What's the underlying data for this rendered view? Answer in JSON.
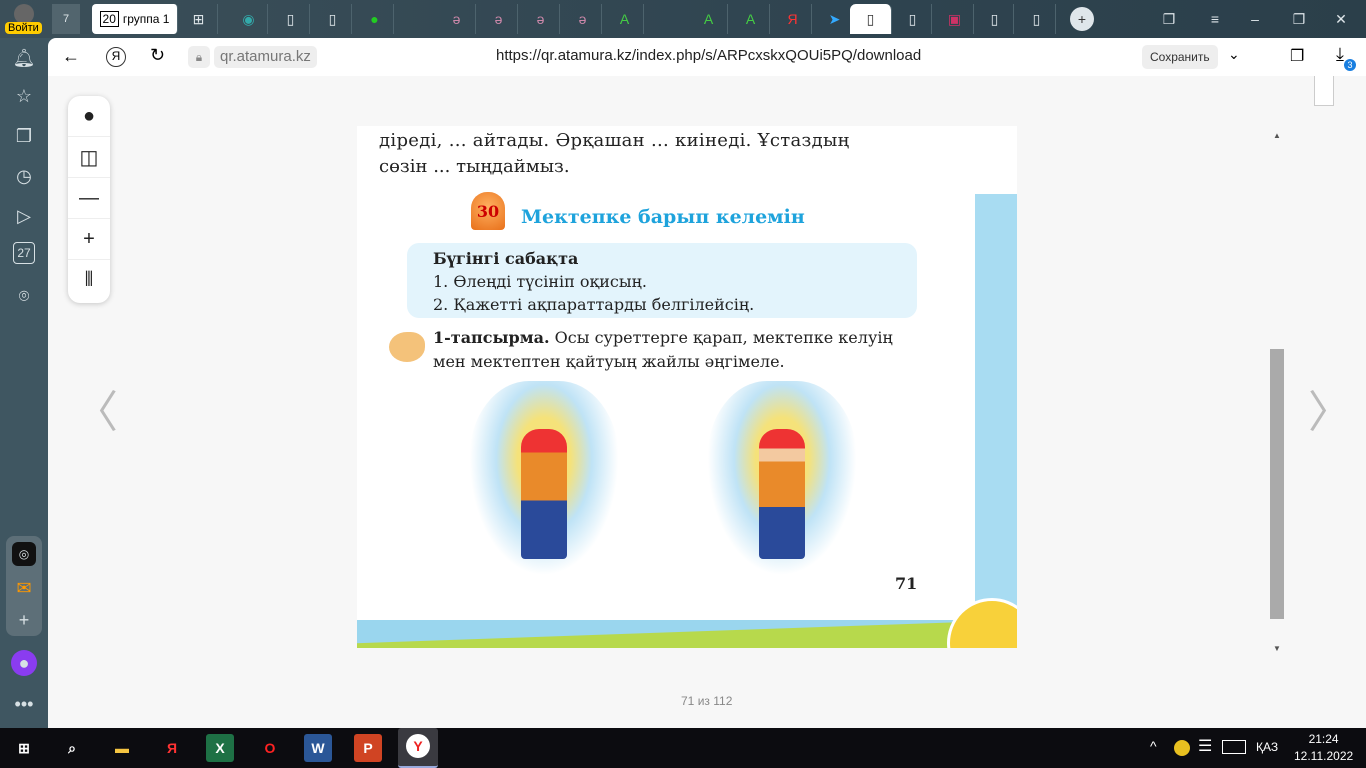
{
  "browser": {
    "login_label": "Войти",
    "home_count": "7",
    "group_count": "20",
    "group_label": "группа 1",
    "url_host": "qr.atamura.kz",
    "url": "https://qr.atamura.kz/index.php/s/ARPcxskxQOUi5PQ/download",
    "save_label": "Сохранить",
    "downloads_badge": "3",
    "sidebar_calendar": "27"
  },
  "page": {
    "line1": "діреді, ... айтады. Әрқашан ... киінеді. Ұстаздың",
    "line2": "сөзін ... тыңдаймыз.",
    "lesson_number": "30",
    "lesson_title": "Мектепке барып келемін",
    "today_title": "Бүгінгі сабақта",
    "today_items": [
      "1. Өлеңді түсініп оқисың.",
      "2. Қажетті ақпараттарды белгілейсің."
    ],
    "task_bold": "1-тапсырма.",
    "task_line1": " Осы суреттерге қарап, мектепке келуің",
    "task_line2": "мен мектептен қайтуың жайлы әңгімеле.",
    "page_number": "71"
  },
  "pager": {
    "current": "71",
    "of": "из",
    "total": "112"
  },
  "taskbar": {
    "lang": "ҚАЗ",
    "time": "21:24",
    "date": "12.11.2022"
  }
}
